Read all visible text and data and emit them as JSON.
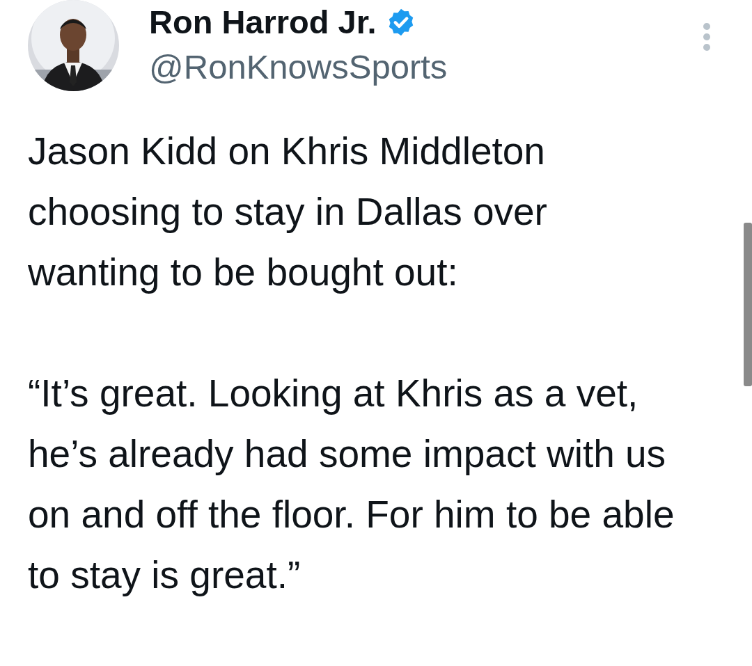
{
  "author": {
    "name": "Ron Harrod Jr.",
    "verified": true,
    "handle": "@RonKnowsSports"
  },
  "body": [
    "Jason Kidd on Khris Middleton choosing to stay in Dallas over wanting to be bought out:",
    "“It’s great. Looking at Khris as a vet, he’s already had some impact with us on and off the floor. For him to be able to stay is great.”"
  ]
}
